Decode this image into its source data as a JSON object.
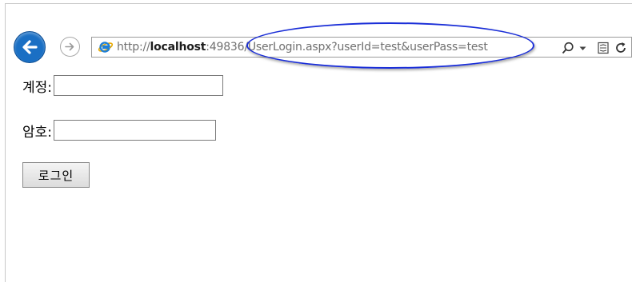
{
  "browser": {
    "address": {
      "scheme": "http://",
      "host": "localhost",
      "path": ":49836/UserLogin.aspx?userId=test&userPass=test"
    },
    "icons": {
      "back": "back-arrow-icon",
      "forward": "forward-arrow-icon",
      "site": "internet-explorer-icon",
      "search": "search-icon",
      "dropdown": "chevron-down-icon",
      "compatibility": "compatibility-view-icon",
      "refresh": "refresh-icon"
    },
    "colors": {
      "back_button": "#1a6fc4",
      "highlight": "#1a2ed8"
    }
  },
  "form": {
    "account_label": "계정:",
    "account_value": "",
    "password_label": "암호:",
    "password_value": "",
    "login_button": "로그인"
  }
}
